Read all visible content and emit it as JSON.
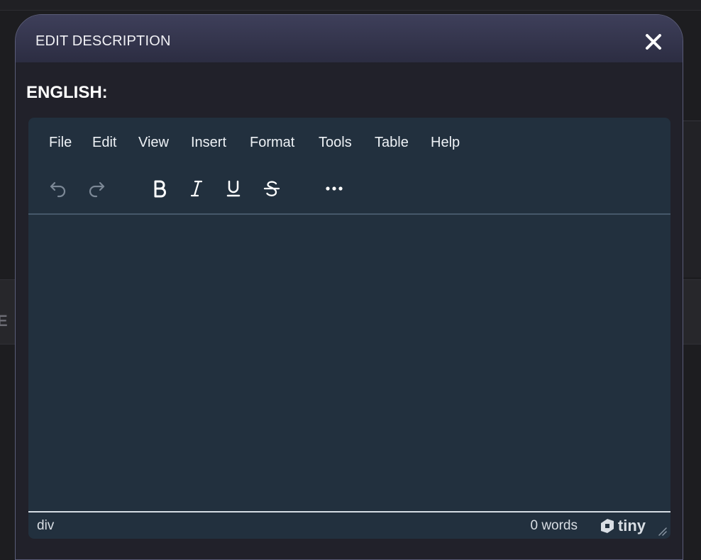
{
  "background": {
    "partial_letter": "E"
  },
  "dialog": {
    "title": "EDIT DESCRIPTION",
    "close_icon": "close-icon"
  },
  "section": {
    "label": "ENGLISH:"
  },
  "editor": {
    "menu": [
      "File",
      "Edit",
      "View",
      "Insert",
      "Format",
      "Tools",
      "Table",
      "Help"
    ],
    "toolbar": [
      {
        "name": "undo-icon",
        "enabled": false
      },
      {
        "name": "redo-icon",
        "enabled": false
      },
      {
        "name": "bold-icon",
        "enabled": true
      },
      {
        "name": "italic-icon",
        "enabled": true
      },
      {
        "name": "underline-icon",
        "enabled": true
      },
      {
        "name": "strikethrough-icon",
        "enabled": true
      },
      {
        "name": "more-icon",
        "enabled": true
      }
    ],
    "status": {
      "path": "div",
      "word_count": "0 words",
      "brand": "tiny"
    }
  },
  "colors": {
    "dialog_header": "#3e3f5a",
    "editor_bg": "#22303e",
    "page_bg": "#1d1d20"
  }
}
